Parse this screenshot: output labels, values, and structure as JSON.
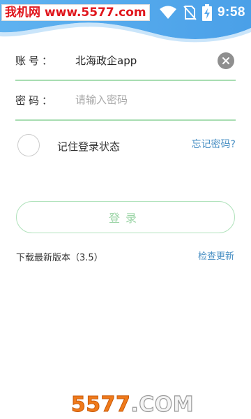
{
  "status_bar": {
    "watermark": "我机网 www.5577.com",
    "time": "9:58",
    "icons": [
      "wifi-icon",
      "no-sim-icon",
      "battery-charging-icon"
    ]
  },
  "form": {
    "account_label": "账号：",
    "account_value": "北海政企app",
    "clear_icon": "close-icon",
    "password_label": "密码：",
    "password_placeholder": "请输入密码",
    "remember_label": "记住登录状态",
    "forgot_link": "忘记密码?",
    "login_button": "登录"
  },
  "footer": {
    "version_text": "下载最新版本（3.5）",
    "update_link": "检查更新"
  },
  "logo": {
    "number": "5577",
    "domain": ".COM"
  },
  "colors": {
    "accent_blue": "#5aa9ec",
    "field_underline": "#a8ddb2",
    "link_blue": "#4a90c4",
    "login_border": "#b2e3bd",
    "watermark_red": "#e0161d"
  }
}
